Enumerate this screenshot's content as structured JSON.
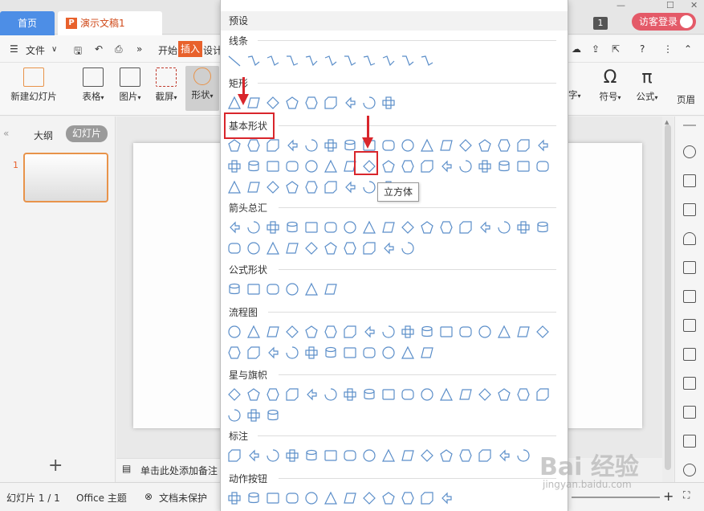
{
  "tabs": {
    "home": "首页",
    "doc": "演示文稿1",
    "ppt_glyph": "P"
  },
  "top_right": {
    "count": "1",
    "login": "访客登录"
  },
  "menu": {
    "file": "文件",
    "start": "开始",
    "insert": "插入",
    "design": "设计"
  },
  "ribbon": {
    "new_slide": "新建幻灯片",
    "table": "表格",
    "image": "图片",
    "screenshot": "截屏",
    "shape": "形状",
    "text_partial": "字",
    "symbol": "符号",
    "formula": "公式",
    "header_partial": "页眉",
    "symbol_glyph": "Ω",
    "formula_glyph": "π"
  },
  "left_pane": {
    "outline": "大纲",
    "slides": "幻灯片",
    "slide_num": "1",
    "add": "+"
  },
  "notes": {
    "placeholder": "单击此处添加备注"
  },
  "status": {
    "slide_count": "幻灯片 1 / 1",
    "theme": "Office 主题",
    "protect": "文档未保护"
  },
  "panel": {
    "preset": "预设",
    "sections": [
      {
        "title": "线条",
        "rows": [
          11
        ]
      },
      {
        "title": "矩形",
        "rows": [
          9
        ]
      },
      {
        "title": "基本形状",
        "rows": [
          17,
          17,
          9
        ]
      },
      {
        "title": "箭头总汇",
        "rows": [
          17,
          10
        ]
      },
      {
        "title": "公式形状",
        "rows": [
          6
        ]
      },
      {
        "title": "流程图",
        "rows": [
          17,
          11
        ]
      },
      {
        "title": "星与旗帜",
        "rows": [
          17,
          3
        ]
      },
      {
        "title": "标注",
        "rows": [
          16
        ]
      },
      {
        "title": "动作按钮",
        "rows": [
          12
        ]
      }
    ],
    "tooltip": "立方体"
  },
  "watermark": {
    "text": "Bai 经验",
    "url": "jingyan.baidu.com"
  },
  "colors": {
    "accent": "#e8612c",
    "shape_stroke": "#5b8ec9",
    "highlight": "#d9262c",
    "home_tab": "#4d8ee6"
  }
}
